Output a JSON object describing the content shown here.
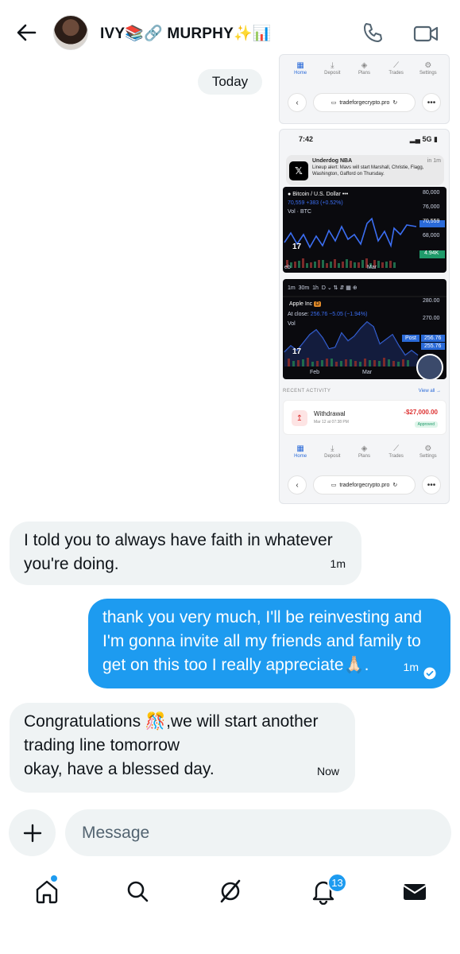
{
  "header": {
    "title": "IVY📚🔗 MURPHY✨📊"
  },
  "date_separator": "Today",
  "screenshot_top": {
    "nav": [
      {
        "glyph": "▦",
        "label": "Home"
      },
      {
        "glyph": "⤓",
        "label": "Deposit"
      },
      {
        "glyph": "◈",
        "label": "Plans"
      },
      {
        "glyph": "⟋",
        "label": "Trades"
      },
      {
        "glyph": "⚙",
        "label": "Settings"
      }
    ],
    "url": "tradeforgecrypto.pro"
  },
  "screenshot_main": {
    "status_time": "7:42",
    "status_network": "5G",
    "notification": {
      "app": "Underdog NBA",
      "age": "in 1m",
      "text": "Lineup alert: Mavs will start Marshall, Christie, Flagg, Washington, Gafford on Thursday."
    },
    "chart1": {
      "symbol": "Bitcoin / U.S. Dollar",
      "quote": "70,559 +383 (+0.52%)",
      "vol_label": "Vol · BTC",
      "price_ticks": [
        "80,000",
        "76,000",
        "72,000",
        "68,000"
      ],
      "last_price": "70,559",
      "vol_value": "4.94K",
      "x_label": "Mar",
      "x_label_left": "eb"
    },
    "chart2": {
      "intervals": [
        "1m",
        "30m",
        "1h",
        "D"
      ],
      "symbol": "Apple Inc",
      "close_label": "At close",
      "close_quote": "256.76  −5.05 (−1.94%)",
      "vol_label": "Vol",
      "price_ticks": [
        "280.00",
        "270.00"
      ],
      "post_label": "Post",
      "post_price": "256.76",
      "last_price": "255.76",
      "x_labels": [
        "Feb",
        "Mar"
      ]
    },
    "recent_label": "RECENT ACTIVITY",
    "view_all": "View all →",
    "withdrawal": {
      "title": "Withdrawal",
      "date": "Mar 12 at 07:38 PM",
      "amount": "-$27,000.00",
      "status": "Approved"
    },
    "nav": [
      {
        "glyph": "▦",
        "label": "Home"
      },
      {
        "glyph": "⤓",
        "label": "Deposit"
      },
      {
        "glyph": "◈",
        "label": "Plans"
      },
      {
        "glyph": "⟋",
        "label": "Trades"
      },
      {
        "glyph": "⚙",
        "label": "Settings"
      }
    ],
    "url": "tradeforgecrypto.pro"
  },
  "messages": [
    {
      "text": "I told you to always have faith in whatever you're doing.",
      "time": "1m"
    },
    {
      "text": "thank you very much, I'll be reinvesting and I'm gonna invite all my friends and family to get on this too I really appreciate🙏🏻.",
      "time": "1m"
    },
    {
      "text": "Congratulations 🎊,we will start another trading line tomorrow\nokay, have a blessed day.",
      "time": "Now"
    }
  ],
  "composer": {
    "placeholder": "Message"
  },
  "bottom_nav": {
    "notifications_badge": "13"
  },
  "colors": {
    "accent": "#1d9bf0",
    "inbound_bubble": "#eff3f4",
    "text": "#0f1419"
  }
}
